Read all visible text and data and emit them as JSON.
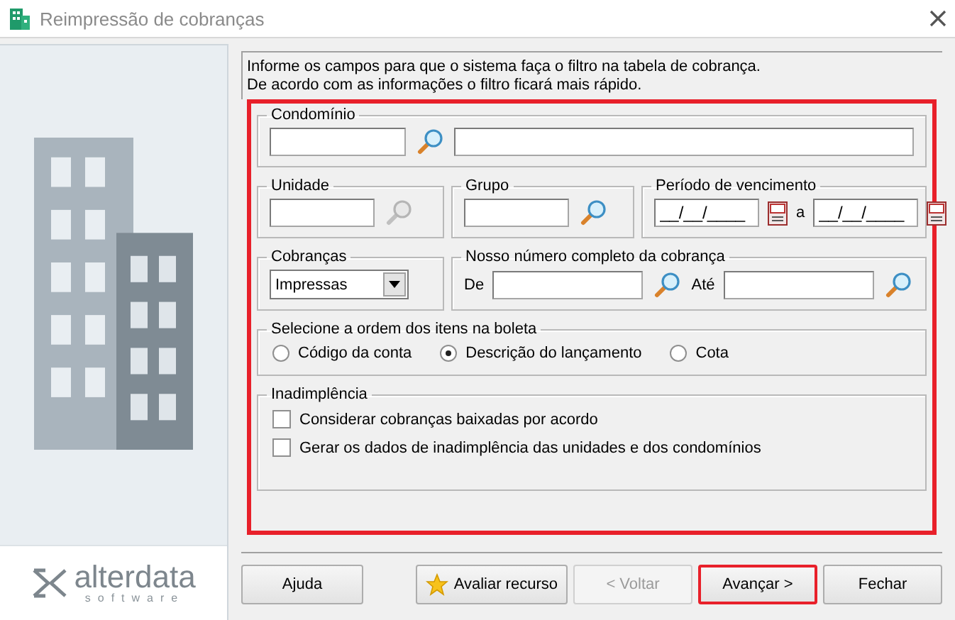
{
  "window": {
    "title": "Reimpressão de cobranças"
  },
  "brand": {
    "name": "alterdata",
    "tagline": "software"
  },
  "intro": [
    "Informe os campos para que o sistema faça o filtro na tabela de cobrança.",
    "De acordo com as informações o filtro ficará mais rápido."
  ],
  "filters": {
    "highlighted": true,
    "condominio": {
      "legend": "Condomínio",
      "search_disabled": false
    },
    "unidade": {
      "legend": "Unidade",
      "search_disabled": true
    },
    "grupo": {
      "legend": "Grupo",
      "search_disabled": false
    },
    "periodo": {
      "legend": "Período de vencimento",
      "from": "__/__/____",
      "separator": "a",
      "to": "__/__/____"
    },
    "cobrancas": {
      "legend": "Cobranças",
      "value": "Impressas"
    },
    "nosso_numero": {
      "legend": "Nosso número completo da cobrança",
      "from_label": "De",
      "to_label": "Até"
    },
    "ordem": {
      "legend": "Selecione a ordem dos itens na boleta",
      "options": [
        {
          "label": "Código da conta",
          "selected": false
        },
        {
          "label": "Descrição do lançamento",
          "selected": true
        },
        {
          "label": "Cota",
          "selected": false
        }
      ]
    },
    "inadimplencia": {
      "legend": "Inadimplência",
      "options": [
        {
          "label": "Considerar cobranças baixadas por acordo",
          "checked": false
        },
        {
          "label": "Gerar os dados de inadimplência das unidades e dos condomínios",
          "checked": false
        }
      ]
    }
  },
  "buttons": [
    {
      "label": "Ajuda",
      "kind": "help",
      "disabled": false,
      "highlighted": false
    },
    {
      "label": "Avaliar recurso",
      "kind": "rate",
      "disabled": false,
      "highlighted": false
    },
    {
      "label": "< Voltar",
      "kind": "nav",
      "disabled": true,
      "highlighted": false
    },
    {
      "label": "Avançar >",
      "kind": "nav",
      "disabled": false,
      "highlighted": true
    },
    {
      "label": "Fechar",
      "kind": "nav",
      "disabled": false,
      "highlighted": false
    }
  ]
}
